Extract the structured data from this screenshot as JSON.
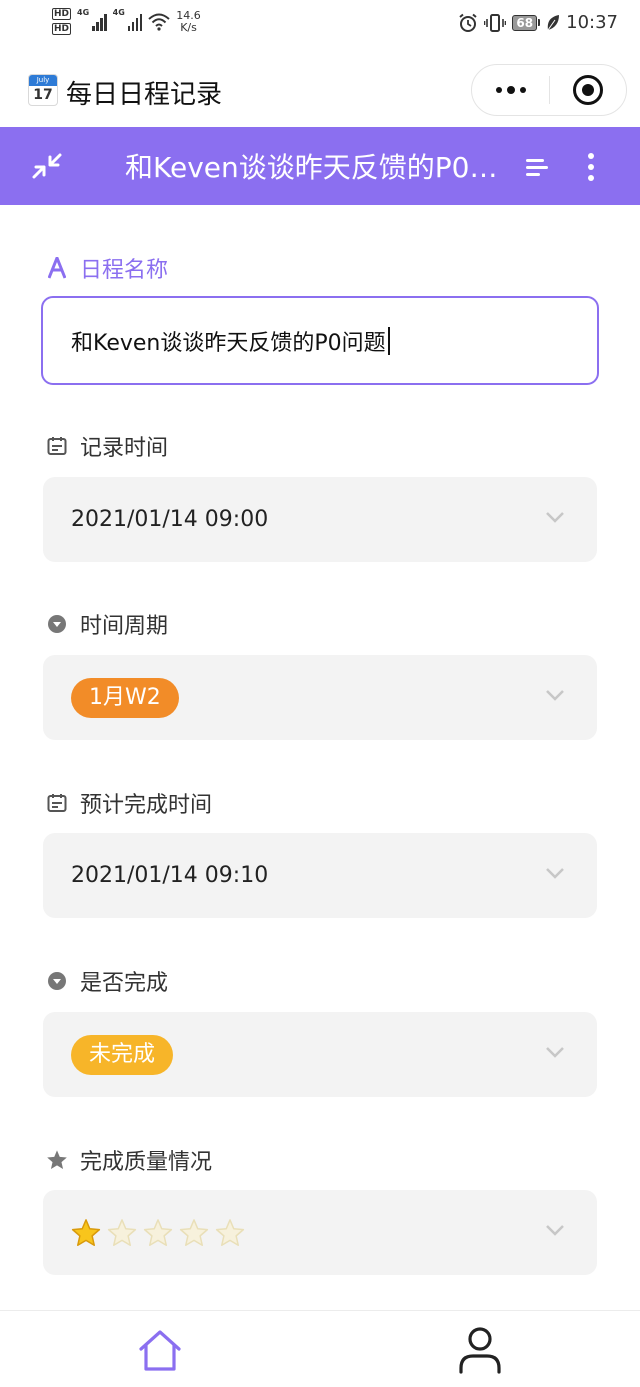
{
  "status_bar": {
    "hd1": "HD",
    "hd2": "HD",
    "net1": "4G",
    "net2": "4G",
    "speed_value": "14.6",
    "speed_unit": "K/s",
    "battery": "68",
    "time": "10:37"
  },
  "app": {
    "title": "每日日程记录",
    "icon_month": "July",
    "icon_day": "17"
  },
  "header": {
    "title": "和Keven谈谈昨天反馈的P0问题",
    "accent_color": "#8b6ff0"
  },
  "fields": {
    "name": {
      "label": "日程名称",
      "value": "和Keven谈谈昨天反馈的P0问题"
    },
    "record_time": {
      "label": "记录时间",
      "value": "2021/01/14 09:00"
    },
    "period": {
      "label": "时间周期",
      "tag": "1月W2",
      "tag_color": "#f28c28"
    },
    "expected_finish": {
      "label": "预计完成时间",
      "value": "2021/01/14 09:10"
    },
    "completed": {
      "label": "是否完成",
      "tag": "未完成",
      "tag_color": "#f7b529"
    },
    "quality": {
      "label": "完成质量情况",
      "rating": 1,
      "max_rating": 5
    }
  },
  "bottom_nav": {
    "items": [
      {
        "icon": "home-icon",
        "active": true
      },
      {
        "icon": "user-icon",
        "active": false
      }
    ]
  }
}
